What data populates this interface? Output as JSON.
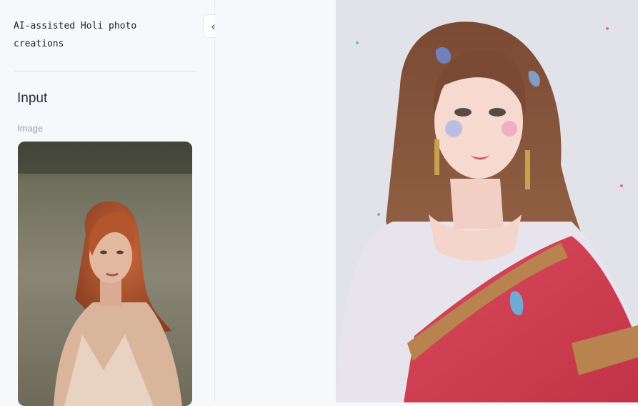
{
  "app": {
    "title": "AI-assisted Holi photo\ncreations"
  },
  "sidebar": {
    "collapse_icon": "chevron-double-left-icon",
    "collapse_glyph": "«",
    "section_title": "Input",
    "image_field_label": "Image"
  },
  "colors": {
    "background": "#f7f8fb",
    "divider": "#dcdfe6",
    "muted_text": "#9aa0aa"
  }
}
